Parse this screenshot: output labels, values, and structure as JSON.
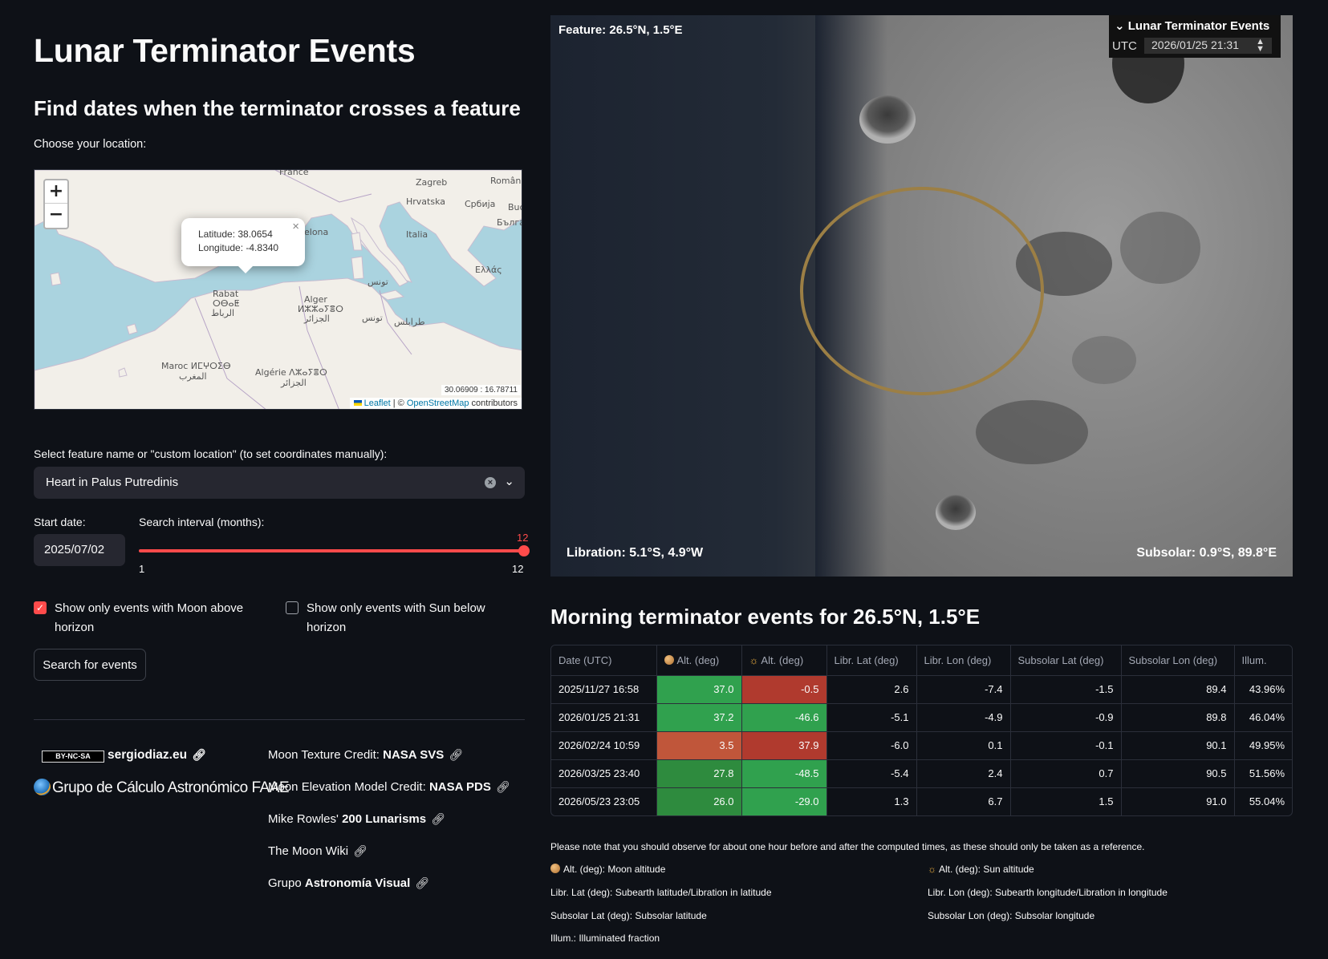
{
  "page_title": "Lunar Terminator Events",
  "subtitle": "Find dates when the terminator crosses a feature",
  "location_label": "Choose your location:",
  "map": {
    "zoom_in": "+",
    "zoom_out": "−",
    "popup_lat": "Latitude: 38.0654",
    "popup_lon": "Longitude: -4.8340",
    "popup_close": "×",
    "labels": {
      "france": "France",
      "zagreb": "Zagreb",
      "romania": "Români",
      "hrvatska": "Hrvatska",
      "srbija": "Србија",
      "buc": "Buc",
      "bulgaria": "Бълга",
      "barcelona": "elona",
      "italia": "Italia",
      "ellas": "Ελλάς",
      "rabat": "Rabat",
      "rabat_tf": "ⵔⴱⴰⵟ",
      "rabat_ar": "الرباط",
      "alger": "Alger",
      "alger_tf": "ⵍⵣⵣⴰⵢⴻⵔ",
      "alger_ar": "الجزائر",
      "tunis_ar": "تونس",
      "tunis_ar2": "تونس",
      "tripoli_ar": "طرابلس",
      "maroc": "Maroc ⵍⵎⵖⵔⵉⴱ",
      "maghrib": "المغرب",
      "algerie": "Algérie ⴷⵣⴰⵢⴻⵔ",
      "algerie_ar": "الجزائر"
    },
    "coords": "30.06909 : 16.78711",
    "attrib_leaflet": "Leaflet",
    "attrib_sep": " | © ",
    "attrib_osm": "OpenStreetMap",
    "attrib_contrib": " contributors"
  },
  "feature_label": "Select feature name or \"custom location\" (to set coordinates manually):",
  "feature_value": "Heart in Palus Putredinis",
  "start_date_label": "Start date:",
  "start_date_value": "2025/07/02",
  "interval_label": "Search interval (months):",
  "interval_value": "12",
  "interval_min": "1",
  "interval_max": "12",
  "checkbox_moon_label": "Show only events with Moon above horizon",
  "checkbox_moon_checked": true,
  "checkbox_sun_label": "Show only events with Sun below horizon",
  "checkbox_sun_checked": false,
  "search_button": "Search for events",
  "footer": {
    "cc_badge": "BY-NC-SA",
    "site": "sergiodiaz.eu",
    "faae": "Grupo de Cálculo Astronómico FAAE",
    "credits": [
      {
        "prefix": "Moon Texture Credit: ",
        "bold": "NASA SVS"
      },
      {
        "prefix": "Moon Elevation Model Credit: ",
        "bold": "NASA PDS"
      },
      {
        "prefix": "Mike Rowles' ",
        "bold": "200 Lunarisms"
      },
      {
        "prefix": "The Moon Wiki",
        "bold": ""
      },
      {
        "prefix": "Grupo ",
        "bold": "Astronomía Visual"
      }
    ]
  },
  "moon_view": {
    "feature": "Feature: 26.5°N, 1.5°E",
    "libration": "Libration: 5.1°S, 4.9°W",
    "subsolar": "Subsolar: 0.9°S, 89.8°E",
    "control_title": "Lunar Terminator Events",
    "control_utc": "UTC",
    "control_date": "2026/01/25 21:31"
  },
  "events_title": "Morning terminator events for 26.5°N, 1.5°E",
  "table": {
    "headers": [
      "Date (UTC)",
      "Alt. (deg)",
      "Alt. (deg)",
      "Libr. Lat (deg)",
      "Libr. Lon (deg)",
      "Subsolar Lat (deg)",
      "Subsolar Lon (deg)",
      "Illum."
    ],
    "rows": [
      [
        "2025/11/27 16:58",
        "37.0",
        "-0.5",
        "2.6",
        "-7.4",
        "-1.5",
        "89.4",
        "43.96%"
      ],
      [
        "2026/01/25 21:31",
        "37.2",
        "-46.6",
        "-5.1",
        "-4.9",
        "-0.9",
        "89.8",
        "46.04%"
      ],
      [
        "2026/02/24 10:59",
        "3.5",
        "37.9",
        "-6.0",
        "0.1",
        "-0.1",
        "90.1",
        "49.95%"
      ],
      [
        "2026/03/25 23:40",
        "27.8",
        "-48.5",
        "-5.4",
        "2.4",
        "0.7",
        "90.5",
        "51.56%"
      ],
      [
        "2026/05/23 23:05",
        "26.0",
        "-29.0",
        "1.3",
        "6.7",
        "1.5",
        "91.0",
        "55.04%"
      ]
    ],
    "colors": {
      "green": "#30a14e",
      "green_dark": "#2e8b3e",
      "red": "#b03a2e",
      "orange_red": "#c0563a"
    }
  },
  "note": "Please note that you should observe for about one hour before and after the computed times, as these should only be taken as a reference.",
  "legend": {
    "moon_alt": "Alt. (deg): Moon altitude",
    "sun_alt": "Alt. (deg): Sun altitude",
    "libr_lat": "Libr. Lat (deg): Subearth latitude/Libration in latitude",
    "libr_lon": "Libr. Lon (deg): Subearth longitude/Libration in longitude",
    "subsolar_lat": "Subsolar Lat (deg): Subsolar latitude",
    "subsolar_lon": "Subsolar Lon (deg): Subsolar longitude",
    "illum": "Illum.: Illuminated fraction"
  },
  "icons": {
    "link": "link-icon",
    "moon": "moon-icon",
    "sun": "sun-icon"
  }
}
